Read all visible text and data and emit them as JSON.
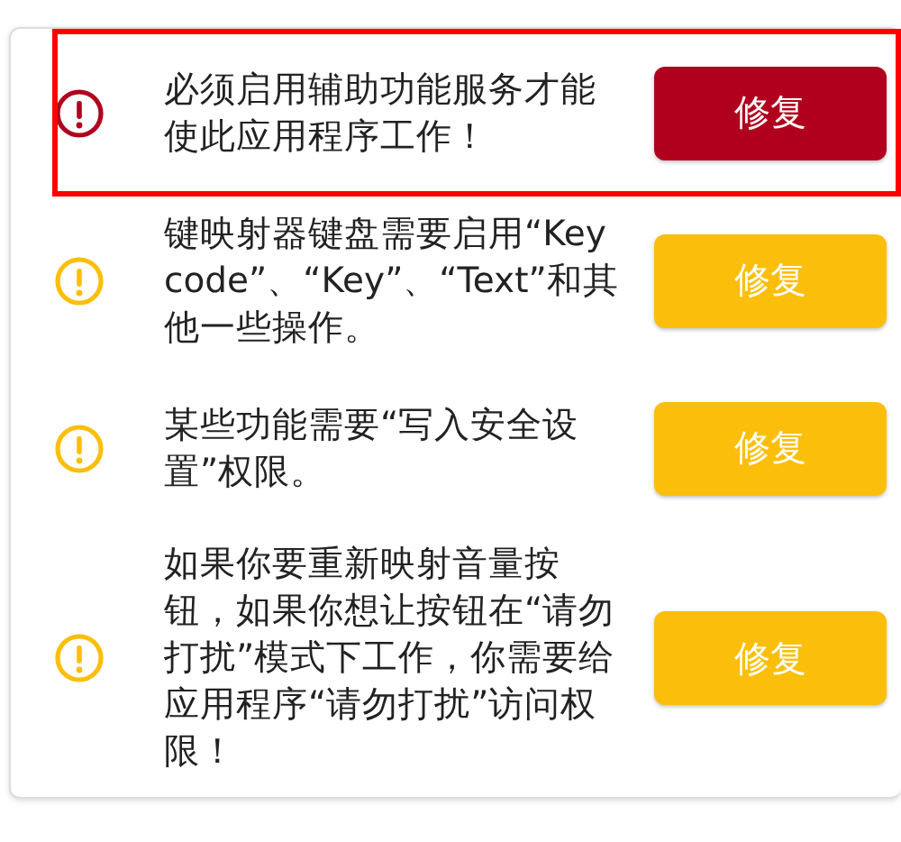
{
  "items": [
    {
      "kind": "error",
      "highlighted": true,
      "message": "必须启用辅助功能服务才能使此应用程序工作！",
      "button": "修复"
    },
    {
      "kind": "warning",
      "highlighted": false,
      "message": "键映射器键盘需要启用“Key code”、“Key”、“Text”和其他一些操作。",
      "button": "修复"
    },
    {
      "kind": "warning",
      "highlighted": false,
      "message": "某些功能需要“写入安全设置”权限。",
      "button": "修复"
    },
    {
      "kind": "warning",
      "highlighted": false,
      "message": "如果你要重新映射音量按钮，如果你想让按钮在“请勿打扰”模式下工作，你需要给应用程序“请勿打扰”访问权限！",
      "button": "修复"
    }
  ]
}
